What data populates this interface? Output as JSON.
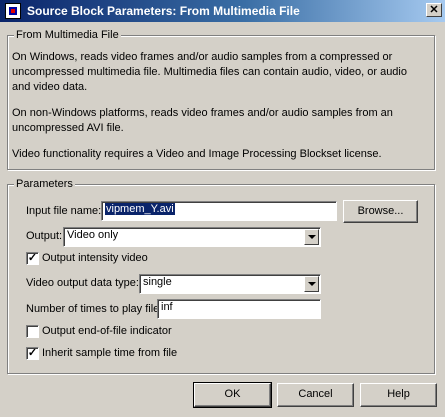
{
  "window": {
    "title": "Source Block Parameters: From Multimedia File",
    "close_glyph": "✕"
  },
  "description_group": {
    "legend": "From Multimedia File",
    "paragraphs": [
      "On Windows, reads video frames and/or audio samples from a compressed or uncompressed multimedia file. Multimedia files can contain audio, video, or audio and video data.",
      "On non-Windows platforms, reads video frames and/or audio samples from an uncompressed AVI file.",
      "Video functionality requires a Video and Image Processing Blockset license."
    ]
  },
  "parameters": {
    "legend": "Parameters",
    "input_file": {
      "label": "Input file name:",
      "value": "vipmem_Y.avi",
      "browse_label": "Browse..."
    },
    "output": {
      "label": "Output:",
      "value": "Video only"
    },
    "output_intensity": {
      "label": "Output intensity video",
      "checked": "✓"
    },
    "video_output_type": {
      "label": "Video output data type:",
      "value": "single"
    },
    "times_to_play": {
      "label": "Number of times to play file:",
      "value": "inf"
    },
    "end_of_file": {
      "label": "Output end-of-file indicator",
      "checked": ""
    },
    "inherit_sample_time": {
      "label": "Inherit sample time from file",
      "checked": "✓"
    }
  },
  "buttons": {
    "ok": "OK",
    "cancel": "Cancel",
    "help": "Help"
  }
}
